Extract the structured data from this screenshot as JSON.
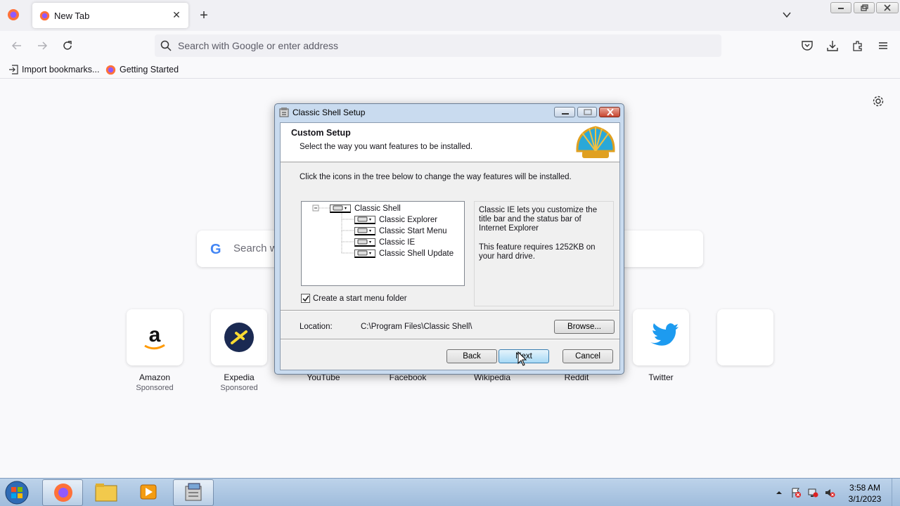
{
  "browser": {
    "tab": {
      "title": "New Tab"
    },
    "urlbar": {
      "placeholder": "Search with Google or enter address"
    },
    "bookmarks": [
      {
        "label": "Import bookmarks..."
      },
      {
        "label": "Getting Started"
      }
    ]
  },
  "newtab": {
    "search_placeholder": "Search w",
    "tiles": [
      {
        "label": "Amazon",
        "sub": "Sponsored"
      },
      {
        "label": "Expedia",
        "sub": "Sponsored"
      },
      {
        "label": "YouTube",
        "sub": ""
      },
      {
        "label": "Facebook",
        "sub": ""
      },
      {
        "label": "Wikipedia",
        "sub": ""
      },
      {
        "label": "Reddit",
        "sub": ""
      },
      {
        "label": "Twitter",
        "sub": ""
      }
    ]
  },
  "dialog": {
    "title": "Classic Shell Setup",
    "heading": "Custom Setup",
    "subheading": "Select the way you want features to be installed.",
    "instruction": "Click the icons in the tree below to change the way features will be installed.",
    "tree": [
      {
        "label": "Classic Shell"
      },
      {
        "label": "Classic Explorer"
      },
      {
        "label": "Classic Start Menu"
      },
      {
        "label": "Classic IE"
      },
      {
        "label": "Classic Shell Update"
      }
    ],
    "description": {
      "line1": "Classic IE lets you customize the title bar and the status bar of Internet Explorer",
      "line2": "This feature requires 1252KB on your hard drive."
    },
    "checkbox_label": "Create a start menu folder",
    "checkbox_checked": true,
    "location_label": "Location:",
    "location_value": "C:\\Program Files\\Classic Shell\\",
    "browse_label": "Browse...",
    "back_label": "Back",
    "next_label": "Next",
    "cancel_label": "Cancel"
  },
  "taskbar": {
    "time": "3:58 AM",
    "date": "3/1/2023"
  }
}
